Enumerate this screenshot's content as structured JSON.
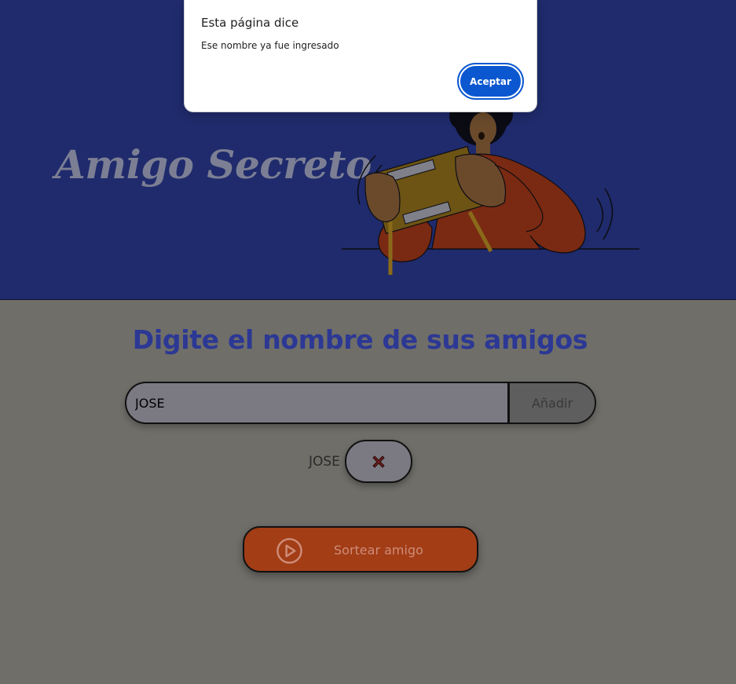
{
  "header": {
    "title": "Amigo Secreto",
    "illustration_icon": "person-shaking-gift-box-illustration"
  },
  "main": {
    "heading": "Digite el nombre de sus amigos",
    "name_input": {
      "value": "JOSE",
      "placeholder": ""
    },
    "add_label": "Añadir",
    "friends": [
      {
        "name": "JOSE",
        "remove_icon": "x-mark-icon"
      }
    ],
    "draw_button": {
      "label": "Sortear amigo",
      "icon": "play-circle-icon"
    }
  },
  "alert": {
    "title": "Esta página dice",
    "message": "Ese nombre ya fue ingresado",
    "accept_label": "Aceptar"
  },
  "colors": {
    "banner": "#1f2b6c",
    "overlay_page": "#6f6e69",
    "heading": "#2c3894",
    "draw_button": "#a23d16",
    "alert_button": "#0b57d0"
  }
}
